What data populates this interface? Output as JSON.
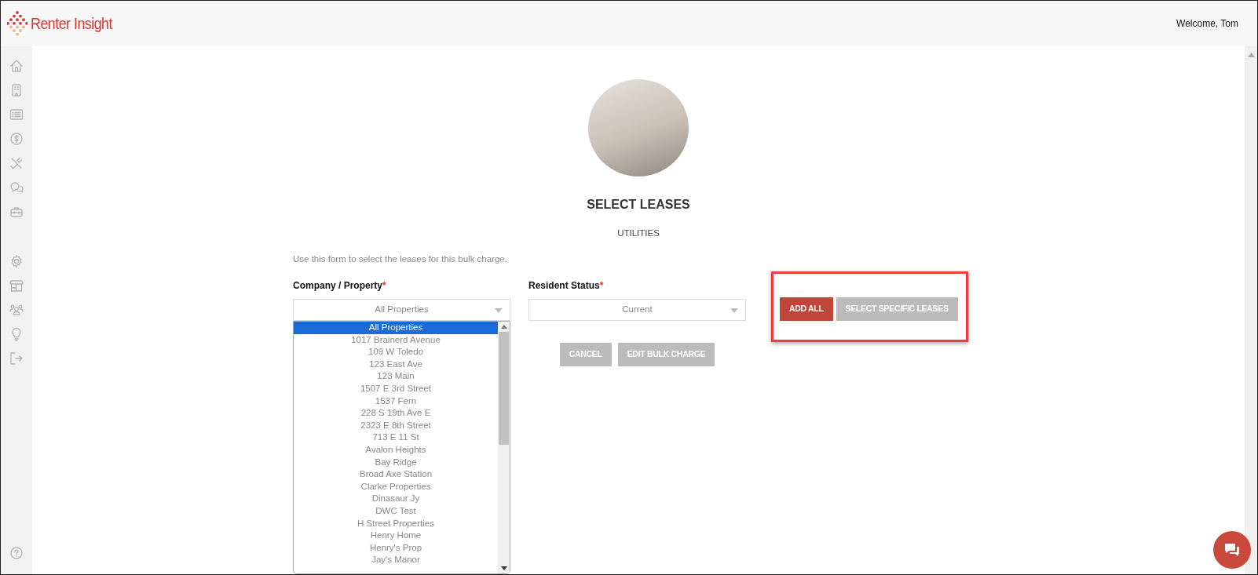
{
  "header": {
    "brand": "Renter Insight",
    "welcome": "Welcome, Tom"
  },
  "page": {
    "title": "SELECT LEASES",
    "subtitle": "UTILITIES",
    "instructions": "Use this form to select the leases for this bulk charge."
  },
  "fields": [
    {
      "label": "Company / Property",
      "required_mark": "*",
      "value": "All Properties"
    },
    {
      "label": "Resident Status",
      "required_mark": "*",
      "value": "Current"
    }
  ],
  "property_list": {
    "items": [
      {
        "label": "All Properties",
        "selected": true
      },
      {
        "label": "1017 Brainerd Avenue",
        "selected": false
      },
      {
        "label": "109 W Toledo",
        "selected": false
      },
      {
        "label": "123 East Ave",
        "selected": false
      },
      {
        "label": "123 Main",
        "selected": false
      },
      {
        "label": "1507 E 3rd Street",
        "selected": false
      },
      {
        "label": "1537 Fern",
        "selected": false
      },
      {
        "label": "228 S 19th Ave E",
        "selected": false
      },
      {
        "label": "2323 E 8th Street",
        "selected": false
      },
      {
        "label": "713 E 11 St",
        "selected": false
      },
      {
        "label": "Avalon Heights",
        "selected": false
      },
      {
        "label": "Bay Ridge",
        "selected": false
      },
      {
        "label": "Broad Axe Station",
        "selected": false
      },
      {
        "label": "Clarke Properties",
        "selected": false
      },
      {
        "label": "Dinasaur Jy",
        "selected": false
      },
      {
        "label": "DWC Test",
        "selected": false
      },
      {
        "label": "H Street Properties",
        "selected": false
      },
      {
        "label": "Henry Home",
        "selected": false
      },
      {
        "label": "Henry's Prop",
        "selected": false
      },
      {
        "label": "Jay's Manor",
        "selected": false
      }
    ]
  },
  "form_buttons": [
    {
      "label": "CANCEL",
      "kind": "secondary"
    },
    {
      "label": "EDIT BULK CHARGE",
      "kind": "secondary"
    }
  ],
  "actions": {
    "highlighted": true,
    "buttons": [
      {
        "label": "ADD ALL",
        "kind": "primary"
      },
      {
        "label": "SELECT SPECIFIC LEASES",
        "kind": "secondary"
      }
    ]
  }
}
